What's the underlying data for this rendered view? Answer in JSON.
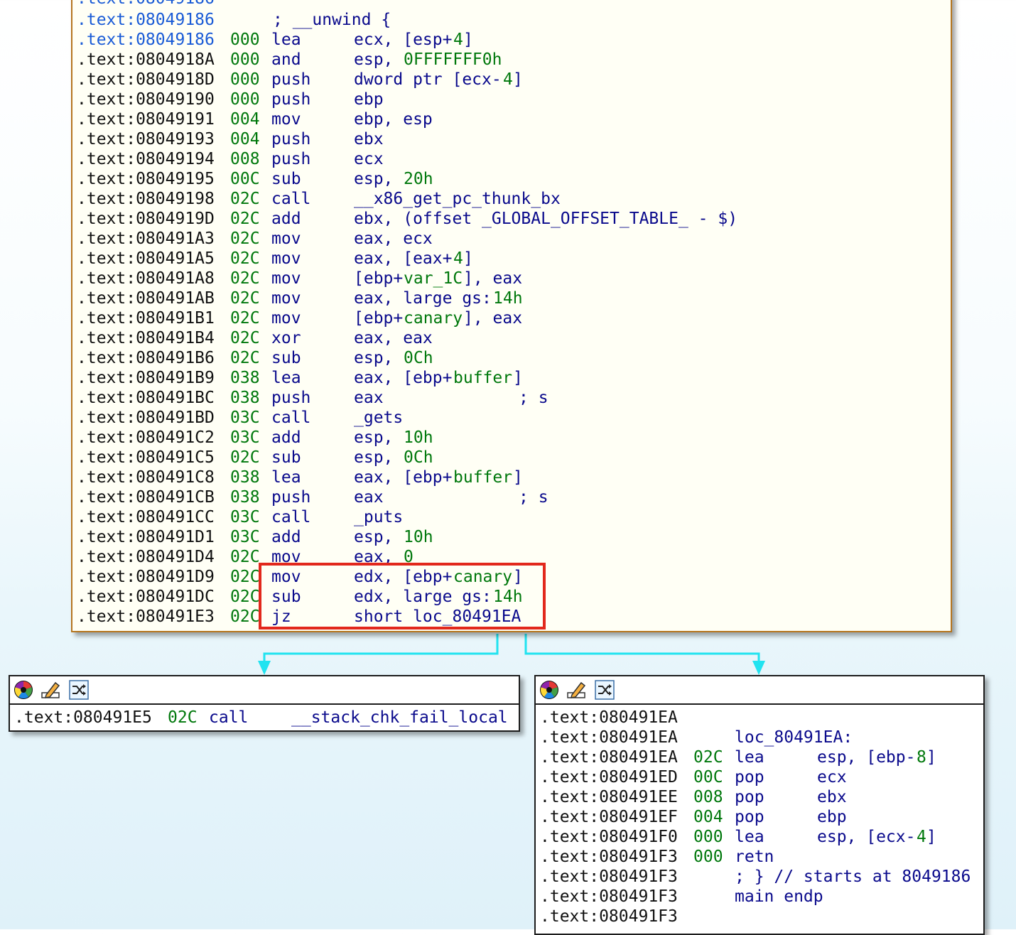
{
  "main_block": {
    "header_addr": ".text:08049186",
    "header_comment": "; __unwind {",
    "rows": [
      {
        "addr": ".text:08049186",
        "sp": "000",
        "mn": "lea",
        "ops": [
          [
            "op",
            "ecx, [esp+"
          ],
          [
            "num",
            "4"
          ],
          [
            "op",
            "]"
          ]
        ]
      },
      {
        "addr": ".text:0804918A",
        "sp": "000",
        "mn": "and",
        "ops": [
          [
            "op",
            "esp, "
          ],
          [
            "num",
            "0FFFFFFF0h"
          ]
        ]
      },
      {
        "addr": ".text:0804918D",
        "sp": "000",
        "mn": "push",
        "ops": [
          [
            "op",
            "dword ptr [ecx-"
          ],
          [
            "num",
            "4"
          ],
          [
            "op",
            "]"
          ]
        ]
      },
      {
        "addr": ".text:08049190",
        "sp": "000",
        "mn": "push",
        "ops": [
          [
            "op",
            "ebp"
          ]
        ]
      },
      {
        "addr": ".text:08049191",
        "sp": "004",
        "mn": "mov",
        "ops": [
          [
            "op",
            "ebp, esp"
          ]
        ]
      },
      {
        "addr": ".text:08049193",
        "sp": "004",
        "mn": "push",
        "ops": [
          [
            "op",
            "ebx"
          ]
        ]
      },
      {
        "addr": ".text:08049194",
        "sp": "008",
        "mn": "push",
        "ops": [
          [
            "op",
            "ecx"
          ]
        ]
      },
      {
        "addr": ".text:08049195",
        "sp": "00C",
        "mn": "sub",
        "ops": [
          [
            "op",
            "esp, "
          ],
          [
            "num",
            "20h"
          ]
        ]
      },
      {
        "addr": ".text:08049198",
        "sp": "02C",
        "mn": "call",
        "ops": [
          [
            "name",
            "__x86_get_pc_thunk_bx"
          ]
        ]
      },
      {
        "addr": ".text:0804919D",
        "sp": "02C",
        "mn": "add",
        "ops": [
          [
            "op",
            "ebx, (offset _GLOBAL_OFFSET_TABLE_ - $)"
          ]
        ]
      },
      {
        "addr": ".text:080491A3",
        "sp": "02C",
        "mn": "mov",
        "ops": [
          [
            "op",
            "eax, ecx"
          ]
        ]
      },
      {
        "addr": ".text:080491A5",
        "sp": "02C",
        "mn": "mov",
        "ops": [
          [
            "op",
            "eax, [eax+"
          ],
          [
            "num",
            "4"
          ],
          [
            "op",
            "]"
          ]
        ]
      },
      {
        "addr": ".text:080491A8",
        "sp": "02C",
        "mn": "mov",
        "ops": [
          [
            "op",
            "[ebp+"
          ],
          [
            "num",
            "var_1C"
          ],
          [
            "op",
            "], eax"
          ]
        ]
      },
      {
        "addr": ".text:080491AB",
        "sp": "02C",
        "mn": "mov",
        "ops": [
          [
            "op",
            "eax, large gs:"
          ],
          [
            "num",
            "14h"
          ]
        ]
      },
      {
        "addr": ".text:080491B1",
        "sp": "02C",
        "mn": "mov",
        "ops": [
          [
            "op",
            "[ebp+"
          ],
          [
            "num",
            "canary"
          ],
          [
            "op",
            "], eax"
          ]
        ]
      },
      {
        "addr": ".text:080491B4",
        "sp": "02C",
        "mn": "xor",
        "ops": [
          [
            "op",
            "eax, eax"
          ]
        ]
      },
      {
        "addr": ".text:080491B6",
        "sp": "02C",
        "mn": "sub",
        "ops": [
          [
            "op",
            "esp, "
          ],
          [
            "num",
            "0Ch"
          ]
        ]
      },
      {
        "addr": ".text:080491B9",
        "sp": "038",
        "mn": "lea",
        "ops": [
          [
            "op",
            "eax, [ebp+"
          ],
          [
            "num",
            "buffer"
          ],
          [
            "op",
            "]"
          ]
        ]
      },
      {
        "addr": ".text:080491BC",
        "sp": "038",
        "mn": "push",
        "ops": [
          [
            "op",
            "eax"
          ]
        ],
        "comment": "; s"
      },
      {
        "addr": ".text:080491BD",
        "sp": "03C",
        "mn": "call",
        "ops": [
          [
            "name",
            "_gets"
          ]
        ]
      },
      {
        "addr": ".text:080491C2",
        "sp": "03C",
        "mn": "add",
        "ops": [
          [
            "op",
            "esp, "
          ],
          [
            "num",
            "10h"
          ]
        ]
      },
      {
        "addr": ".text:080491C5",
        "sp": "02C",
        "mn": "sub",
        "ops": [
          [
            "op",
            "esp, "
          ],
          [
            "num",
            "0Ch"
          ]
        ]
      },
      {
        "addr": ".text:080491C8",
        "sp": "038",
        "mn": "lea",
        "ops": [
          [
            "op",
            "eax, [ebp+"
          ],
          [
            "num",
            "buffer"
          ],
          [
            "op",
            "]"
          ]
        ]
      },
      {
        "addr": ".text:080491CB",
        "sp": "038",
        "mn": "push",
        "ops": [
          [
            "op",
            "eax"
          ]
        ],
        "comment": "; s"
      },
      {
        "addr": ".text:080491CC",
        "sp": "03C",
        "mn": "call",
        "ops": [
          [
            "name",
            "_puts"
          ]
        ]
      },
      {
        "addr": ".text:080491D1",
        "sp": "03C",
        "mn": "add",
        "ops": [
          [
            "op",
            "esp, "
          ],
          [
            "num",
            "10h"
          ]
        ]
      },
      {
        "addr": ".text:080491D4",
        "sp": "02C",
        "mn": "mov",
        "ops": [
          [
            "op",
            "eax, "
          ],
          [
            "num",
            "0"
          ]
        ]
      },
      {
        "addr": ".text:080491D9",
        "sp": "02C",
        "mn": "mov",
        "ops": [
          [
            "op",
            "edx, [ebp+"
          ],
          [
            "num",
            "canary"
          ],
          [
            "op",
            "]"
          ]
        ]
      },
      {
        "addr": ".text:080491DC",
        "sp": "02C",
        "mn": "sub",
        "ops": [
          [
            "op",
            "edx, large gs:"
          ],
          [
            "num",
            "14h"
          ]
        ]
      },
      {
        "addr": ".text:080491E3",
        "sp": "02C",
        "mn": "jz",
        "ops": [
          [
            "op",
            "short loc_80491EA"
          ]
        ]
      }
    ]
  },
  "left_block": {
    "rows": [
      {
        "addr": ".text:080491E5",
        "sp": "02C",
        "mn": "call",
        "ops": [
          [
            "name",
            "__stack_chk_fail_local"
          ]
        ]
      }
    ]
  },
  "right_block": {
    "rows": [
      {
        "addr": ".text:080491EA"
      },
      {
        "addr": ".text:080491EA",
        "label": "loc_80491EA:"
      },
      {
        "addr": ".text:080491EA",
        "sp": "02C",
        "mn": "lea",
        "ops": [
          [
            "op",
            "esp, [ebp-"
          ],
          [
            "num",
            "8"
          ],
          [
            "op",
            "]"
          ]
        ]
      },
      {
        "addr": ".text:080491ED",
        "sp": "00C",
        "mn": "pop",
        "ops": [
          [
            "op",
            "ecx"
          ]
        ]
      },
      {
        "addr": ".text:080491EE",
        "sp": "008",
        "mn": "pop",
        "ops": [
          [
            "op",
            "ebx"
          ]
        ]
      },
      {
        "addr": ".text:080491EF",
        "sp": "004",
        "mn": "pop",
        "ops": [
          [
            "op",
            "ebp"
          ]
        ]
      },
      {
        "addr": ".text:080491F0",
        "sp": "000",
        "mn": "lea",
        "ops": [
          [
            "op",
            "esp, [ecx-"
          ],
          [
            "num",
            "4"
          ],
          [
            "op",
            "]"
          ]
        ]
      },
      {
        "addr": ".text:080491F3",
        "sp": "000",
        "mn": "retn",
        "ops": []
      },
      {
        "addr": ".text:080491F3",
        "label": "; } // starts at 8049186"
      },
      {
        "addr": ".text:080491F3",
        "label": "main endp"
      },
      {
        "addr": ".text:080491F3"
      }
    ]
  },
  "toolbar_icons": [
    "color-palette-icon",
    "rename-pencil-icon",
    "graph-layout-icon"
  ],
  "colors": {
    "address_blue": "#1a5bd6",
    "numeric_green": "#00780c",
    "mnemonic_navy": "#0a0a8c",
    "highlight_red": "#e2281c",
    "edge_cyan": "#21e3f0",
    "block_border": "#b5751f"
  }
}
